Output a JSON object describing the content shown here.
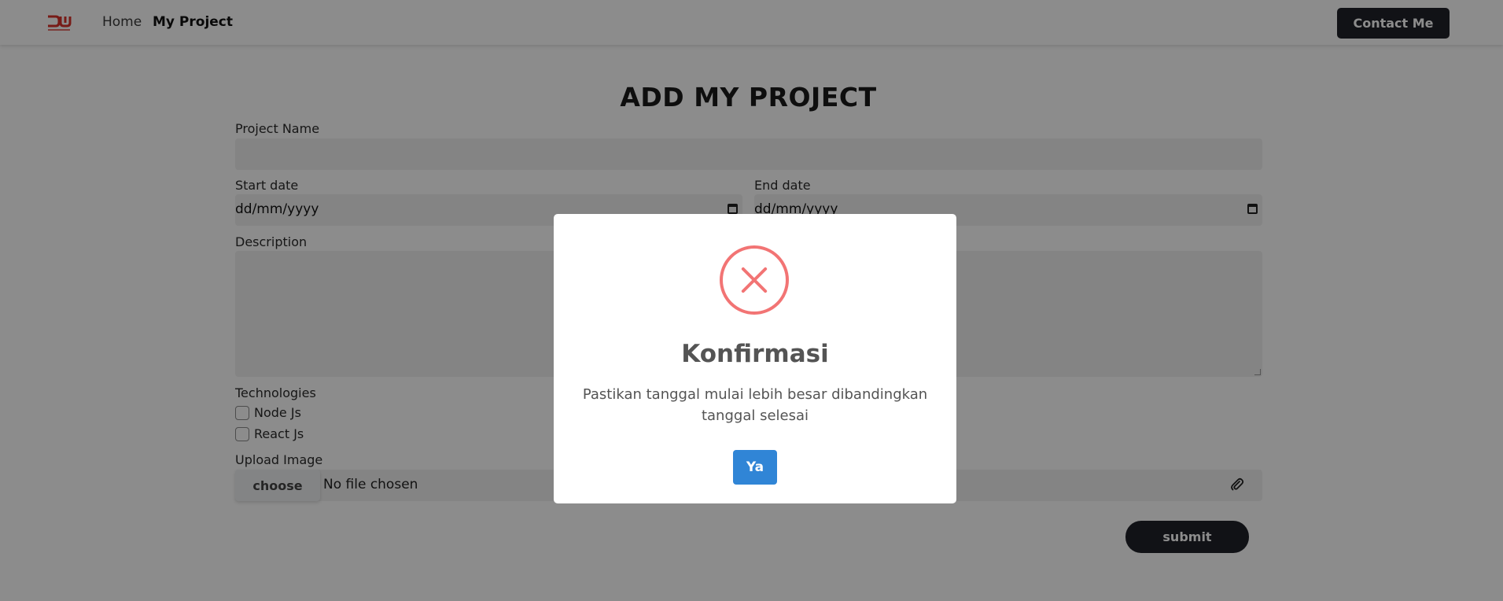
{
  "navbar": {
    "home": "Home",
    "my_project": "My Project",
    "contact": "Contact Me"
  },
  "form": {
    "title": "ADD MY PROJECT",
    "project_name_label": "Project Name",
    "project_name_value": "",
    "start_date_label": "Start date",
    "start_date_placeholder": "dd/mm/yyyy",
    "end_date_label": "End date",
    "end_date_placeholder": "dd/mm/yyyy",
    "description_label": "Description",
    "description_value": "",
    "technologies_label": "Technologies",
    "technologies": [
      {
        "label": "Node Js",
        "checked": false
      },
      {
        "label": "React Js",
        "checked": false
      }
    ],
    "upload_label": "Upload Image",
    "choose_label": "choose",
    "no_file": "No file chosen",
    "submit": "submit"
  },
  "modal": {
    "title": "Konfirmasi",
    "message": "Pastikan tanggal mulai lebih besar dibandingkan tanggal selesai",
    "confirm": "Ya",
    "icon": "error-x-icon"
  },
  "colors": {
    "brand_red": "#d9322b",
    "dark_button": "#1f2128",
    "confirm_blue": "#3085d6",
    "error_red": "#f27474",
    "overlay": "rgba(0,0,0,0.45)"
  }
}
